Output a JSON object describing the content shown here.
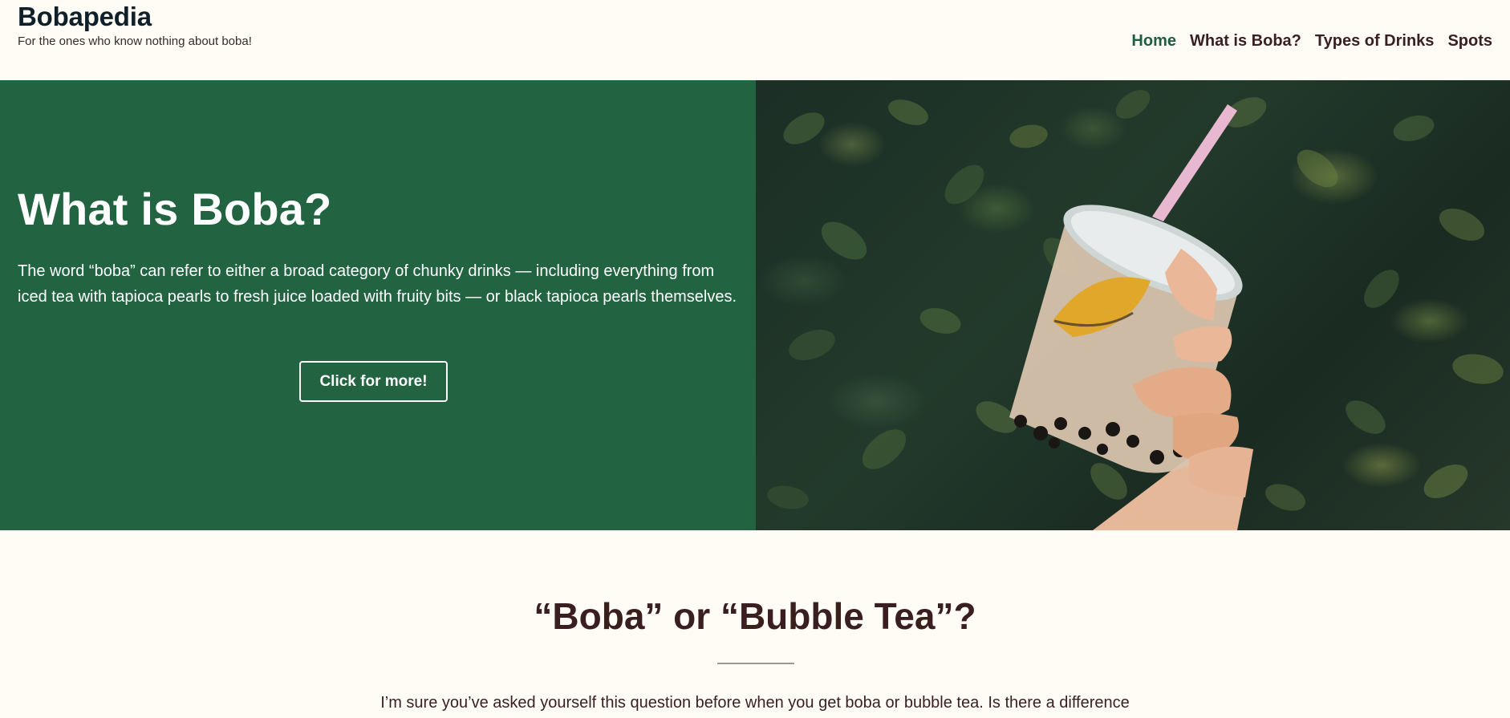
{
  "header": {
    "site_title": "Bobapedia",
    "tagline": "For the ones who know nothing about boba!",
    "nav": [
      {
        "label": "Home",
        "active": true
      },
      {
        "label": "What is Boba?",
        "active": false
      },
      {
        "label": "Types of Drinks",
        "active": false
      },
      {
        "label": "Spots",
        "active": false
      }
    ]
  },
  "hero": {
    "title": "What is Boba?",
    "text": "The word “boba” can refer to either a broad category of chunky drinks — including everything from iced tea with tapioca pearls to fresh juice loaded with fruity bits — or black tapioca pearls themselves.",
    "button_label": "Click for more!",
    "background_color": "#226441",
    "image_subject": "hand-holding-bubble-tea-cup"
  },
  "section": {
    "heading": "“Boba” or “Bubble Tea”?",
    "text": "I’m sure you’ve asked yourself this question before when you get boba or bubble tea. Is there a difference"
  },
  "colors": {
    "page_background": "#fffcf5",
    "accent_green": "#1f5e3e",
    "text_brown": "#3a1f1f"
  }
}
